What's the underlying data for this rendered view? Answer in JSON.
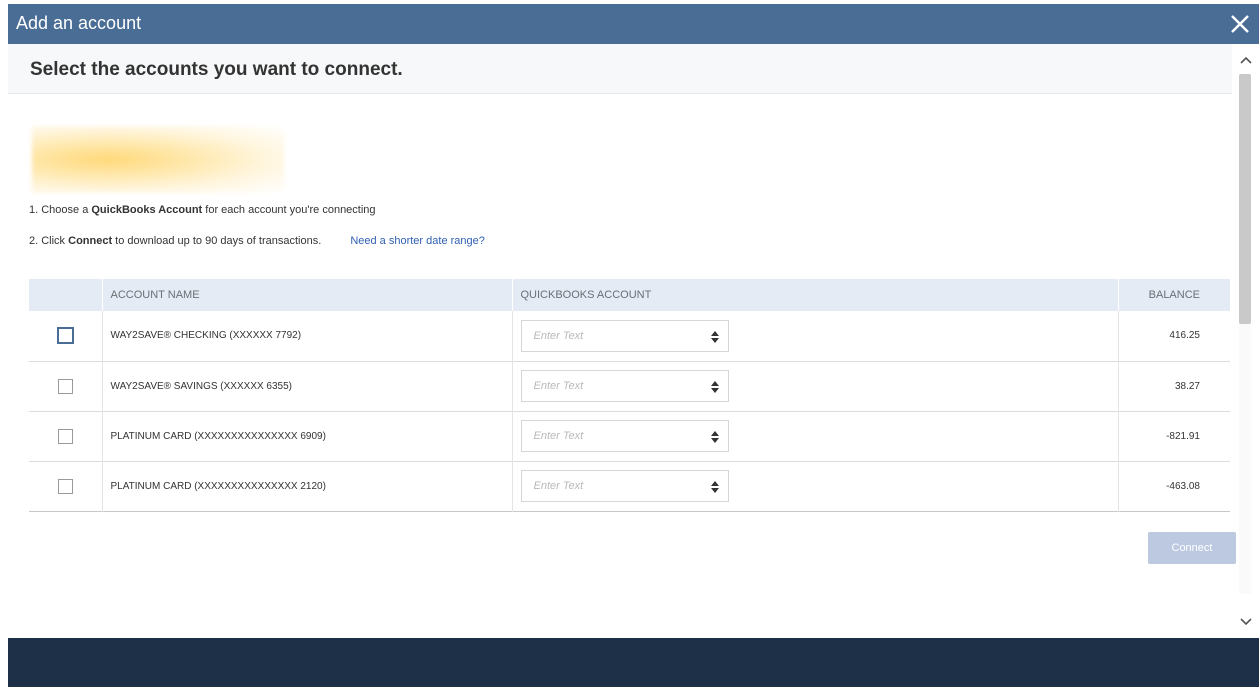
{
  "dialog": {
    "title": "Add an account",
    "close_icon": "close-icon"
  },
  "subheader": {
    "title": "Select the accounts you want to connect."
  },
  "instructions": {
    "step1_prefix": "1. Choose a ",
    "step1_bold": "QuickBooks Account",
    "step1_suffix": " for each account you're connecting",
    "step2_prefix": "2. Click ",
    "step2_bold": "Connect",
    "step2_suffix": " to download up to 90 days of transactions.",
    "date_range_link": "Need a shorter date range?"
  },
  "table": {
    "headers": {
      "account_name": "ACCOUNT NAME",
      "quickbooks_account": "QUICKBOOKS ACCOUNT",
      "balance": "BALANCE"
    },
    "rows": [
      {
        "name": "WAY2SAVE® CHECKING (XXXXXX 7792)",
        "qb_placeholder": "Enter Text",
        "balance": "416.25",
        "checked": false,
        "focused": true
      },
      {
        "name": "WAY2SAVE® SAVINGS (XXXXXX 6355)",
        "qb_placeholder": "Enter Text",
        "balance": "38.27",
        "checked": false,
        "focused": false
      },
      {
        "name": "PLATINUM CARD (XXXXXXXXXXXXXXX 6909)",
        "qb_placeholder": "Enter Text",
        "balance": "-821.91",
        "checked": false,
        "focused": false
      },
      {
        "name": "PLATINUM CARD (XXXXXXXXXXXXXXX 2120)",
        "qb_placeholder": "Enter Text",
        "balance": "-463.08",
        "checked": false,
        "focused": false
      }
    ]
  },
  "actions": {
    "connect_label": "Connect"
  },
  "colors": {
    "header_bg": "#4a6d96",
    "footer_bg": "#1e3048",
    "link": "#2f5fb3",
    "connect_disabled": "#bcc9e0"
  }
}
